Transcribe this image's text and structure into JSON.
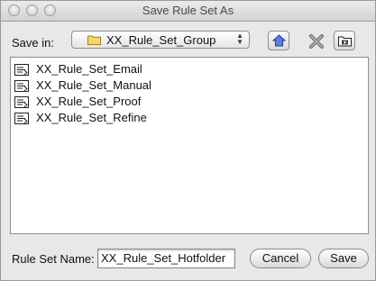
{
  "window": {
    "title": "Save Rule Set As"
  },
  "location": {
    "label": "Save in:",
    "folder": "XX_Rule_Set_Group"
  },
  "toolbar": {
    "icons": [
      "home-icon",
      "delete-icon",
      "new-folder-icon"
    ]
  },
  "files": [
    {
      "name": "XX_Rule_Set_Email"
    },
    {
      "name": "XX_Rule_Set_Manual"
    },
    {
      "name": "XX_Rule_Set_Proof"
    },
    {
      "name": "XX_Rule_Set_Refine"
    }
  ],
  "footer": {
    "name_label": "Rule Set Name:",
    "name_value": "XX_Rule_Set_Hotfolder",
    "cancel_label": "Cancel",
    "save_label": "Save"
  },
  "colors": {
    "folder": "#f3d76a",
    "file_icon_border": "#222222"
  }
}
